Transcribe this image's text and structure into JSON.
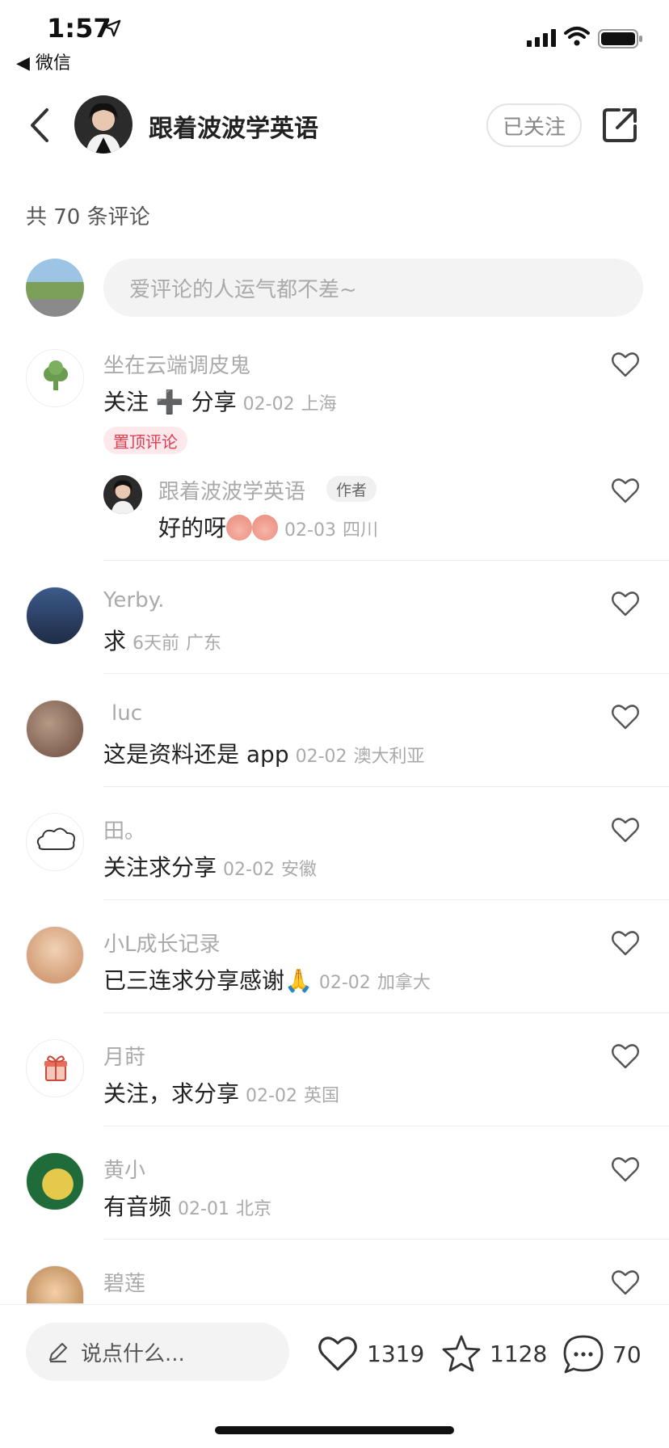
{
  "status_bar": {
    "time": "1:57",
    "back_app": "◀ 微信"
  },
  "header": {
    "title": "跟着波波学英语",
    "follow_label": "已关注"
  },
  "comments_count_label": "共 70 条评论",
  "comment_input": {
    "placeholder": "爱评论的人运气都不差~"
  },
  "comments": [
    {
      "name": "坐在云端调皮鬼",
      "text": "关注 ➕ 分享",
      "time": "02-02",
      "location": "上海",
      "pinned_label": "置顶评论",
      "reply": {
        "name": "跟着波波学英语",
        "author_tag": "作者",
        "text": "好的呀",
        "time": "02-03",
        "location": "四川"
      }
    },
    {
      "name": "Yerby.",
      "text": "求",
      "time": "6天前",
      "location": "广东"
    },
    {
      "name": "luc",
      "text": "这是资料还是 app",
      "time": "02-02",
      "location": "澳大利亚"
    },
    {
      "name": "田。",
      "text": "关注求分享",
      "time": "02-02",
      "location": "安徽"
    },
    {
      "name": "小L成长记录",
      "text": "已三连求分享感谢🙏",
      "time": "02-02",
      "location": "加拿大"
    },
    {
      "name": "月莳",
      "text": "关注，求分享",
      "time": "02-02",
      "location": "英国"
    },
    {
      "name": "黄小",
      "text": "有音频",
      "time": "02-01",
      "location": "北京"
    },
    {
      "name": "碧莲"
    }
  ],
  "bottom_bar": {
    "say_placeholder": "说点什么...",
    "likes": "1319",
    "favorites": "1128",
    "comments": "70"
  }
}
